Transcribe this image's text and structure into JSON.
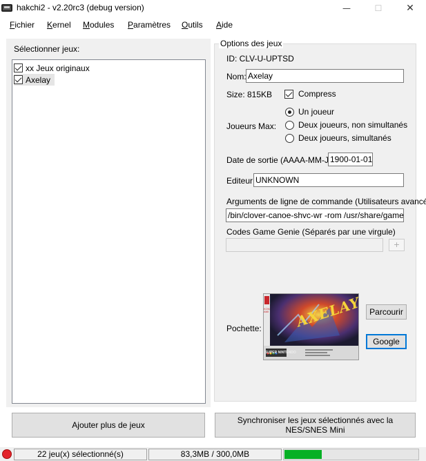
{
  "window": {
    "title": "hakchi2 - v2.20rc3 (debug version)",
    "minimize_glyph": "—",
    "maximize_glyph": "☐",
    "close_glyph": "✕"
  },
  "menu": {
    "items": [
      {
        "first": "F",
        "rest": "ichier"
      },
      {
        "first": "K",
        "rest": "ernel"
      },
      {
        "first": "M",
        "rest": "odules"
      },
      {
        "first": "P",
        "rest": "aramètres"
      },
      {
        "first": "O",
        "rest": "utils"
      },
      {
        "first": "A",
        "rest": "ide"
      }
    ]
  },
  "games_panel": {
    "label": "Sélectionner jeux:",
    "items": [
      {
        "label": "xx Jeux originaux",
        "checked": true
      },
      {
        "label": "Axelay",
        "checked": true
      }
    ]
  },
  "options": {
    "legend": "Options des jeux",
    "id_text": "ID: CLV-U-UPTSD",
    "name_label": "Nom:",
    "name_value": "Axelay",
    "size_text": "Size: 815KB",
    "compress_label": "Compress",
    "compress_checked": true,
    "players_label": "Joueurs Max:",
    "players_options": [
      "Un joueur",
      "Deux joueurs, non simultanés",
      "Deux joueurs, simultanés"
    ],
    "players_selected": 0,
    "release_label": "Date de sortie (AAAA-MM-JJ):",
    "release_value": "1900-01-01",
    "publisher_label": "Editeur:",
    "publisher_value": "UNKNOWN",
    "args_label": "Arguments de ligne de commande (Utilisateurs avancés!)",
    "args_value": "/bin/clover-canoe-shvc-wr -rom /usr/share/games/C",
    "genie_label": "Codes Game Genie (Séparés par une virgule)",
    "genie_value": "",
    "genie_add": "+",
    "cover_label": "Pochette:",
    "browse_button": "Parcourir",
    "google_button": "Google",
    "cover_art": {
      "publisher_logo": "KONAMI",
      "game_title": "AXELAY",
      "console_brand": "SUPER NINTENDO"
    }
  },
  "buttons": {
    "add_games": "Ajouter plus de jeux",
    "sync": "Synchroniser les jeux sélectionnés avec la NES/SNES Mini"
  },
  "status": {
    "selected_count": "22 jeu(x) sélectionné(s)",
    "storage": "83,3MB / 300,0MB",
    "storage_fraction": 0.278,
    "progress_color": "#06b025",
    "status_color": "#e3242b"
  }
}
